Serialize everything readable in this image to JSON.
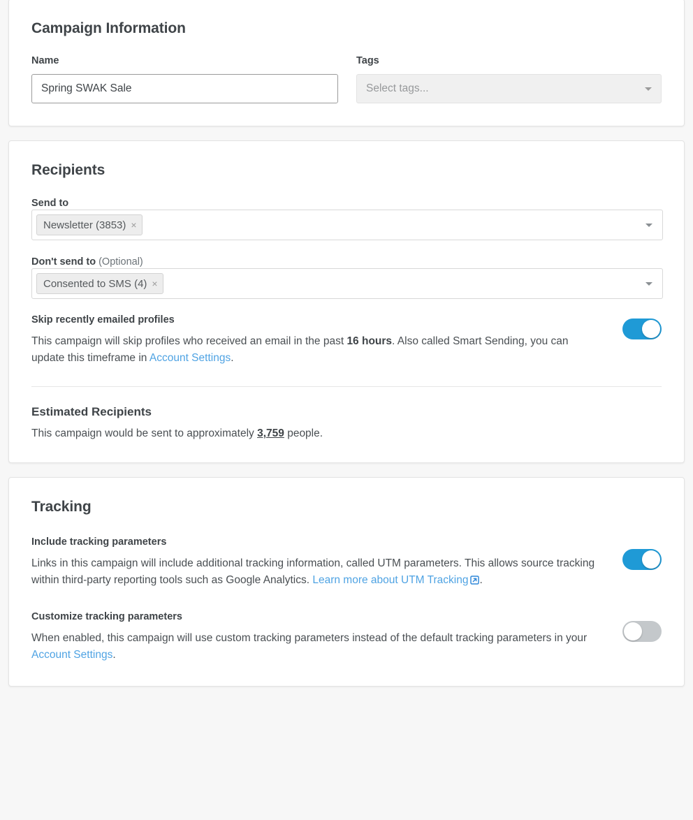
{
  "campaign_information": {
    "title": "Campaign Information",
    "name_label": "Name",
    "name_value": "Spring SWAK Sale",
    "tags_label": "Tags",
    "tags_placeholder": "Select tags...",
    "tags_caret_icon": "chevron-down-icon"
  },
  "recipients": {
    "title": "Recipients",
    "send_to_label": "Send to",
    "send_to_chip": "Newsletter (3853)",
    "send_to_chip_remove": "×",
    "dont_send_to_label": "Don't send to",
    "dont_send_to_optional": " (Optional)",
    "dont_send_to_chip": "Consented to SMS (4)",
    "dont_send_to_chip_remove": "×",
    "caret_icon": "chevron-down-icon",
    "skip": {
      "label": "Skip recently emailed profiles",
      "text_part1": "This campaign will skip profiles who received an email in the past ",
      "bold_value": "16 hours",
      "text_part2": ". Also called Smart Sending, you can update this timeframe in ",
      "link_label": "Account Settings",
      "text_part3": ".",
      "toggle_state": "on"
    },
    "estimated": {
      "title": "Estimated Recipients",
      "text_part1": "This campaign would be sent to approximately ",
      "count": "3,759",
      "text_part2": " people."
    }
  },
  "tracking": {
    "title": "Tracking",
    "include": {
      "label": "Include tracking parameters",
      "text_part1": "Links in this campaign will include additional tracking information, called UTM parameters. This allows source tracking within third-party reporting tools such as Google Analytics. ",
      "link_label": "Learn more about UTM Tracking",
      "link_icon": "external-link-icon",
      "text_part2": ".",
      "toggle_state": "on"
    },
    "customize": {
      "label": "Customize tracking parameters",
      "text_part1": "When enabled, this campaign will use custom tracking parameters instead of the default tracking parameters in your ",
      "link_label": "Account Settings",
      "text_part2": ".",
      "toggle_state": "off"
    }
  },
  "colors": {
    "toggle_on": "#1f9ad6",
    "toggle_off": "#c4c8cb",
    "link": "#4fa3e3",
    "page_bg": "#f7f7f7",
    "card_bg": "#ffffff"
  }
}
